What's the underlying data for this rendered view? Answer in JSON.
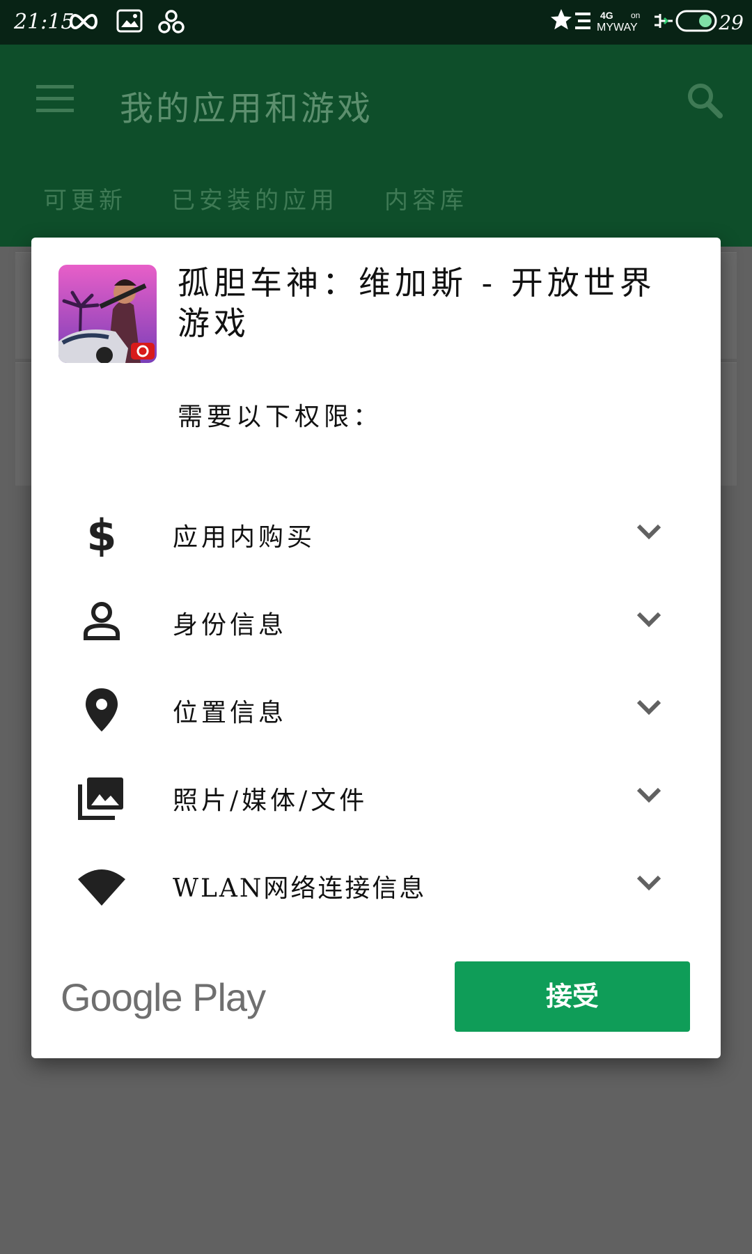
{
  "status_bar": {
    "time": "21:15",
    "network_label": "4G",
    "carrier": "MYWAY",
    "on_label": "on",
    "battery": "29",
    "icons": [
      "infinity-icon",
      "gallery-icon",
      "pinwheel-icon",
      "star-icon",
      "signal-list-icon",
      "charging-icon",
      "toggle-icon"
    ]
  },
  "app_bar": {
    "title": "我的应用和游戏",
    "tabs": [
      {
        "label": "可更新"
      },
      {
        "label": "已安装的应用"
      },
      {
        "label": "内容库"
      }
    ]
  },
  "dialog": {
    "app_name": "孤胆车神：维加斯 - 开放世界游戏",
    "heading": "需要以下权限：",
    "permissions": [
      {
        "label": "应用内购买",
        "icon": "dollar-icon"
      },
      {
        "label": "身份信息",
        "icon": "person-icon"
      },
      {
        "label": "位置信息",
        "icon": "location-pin-icon"
      },
      {
        "label": "照片/媒体/文件",
        "icon": "photo-library-icon"
      },
      {
        "label": "WLAN网络连接信息",
        "icon": "wifi-icon"
      }
    ],
    "brand": "Google Play",
    "accept_label": "接受",
    "accept_color": "#0f9d58"
  },
  "colors": {
    "app_bar": "#0e4e2a",
    "status_bar": "#082315",
    "scrim": "#616161"
  }
}
